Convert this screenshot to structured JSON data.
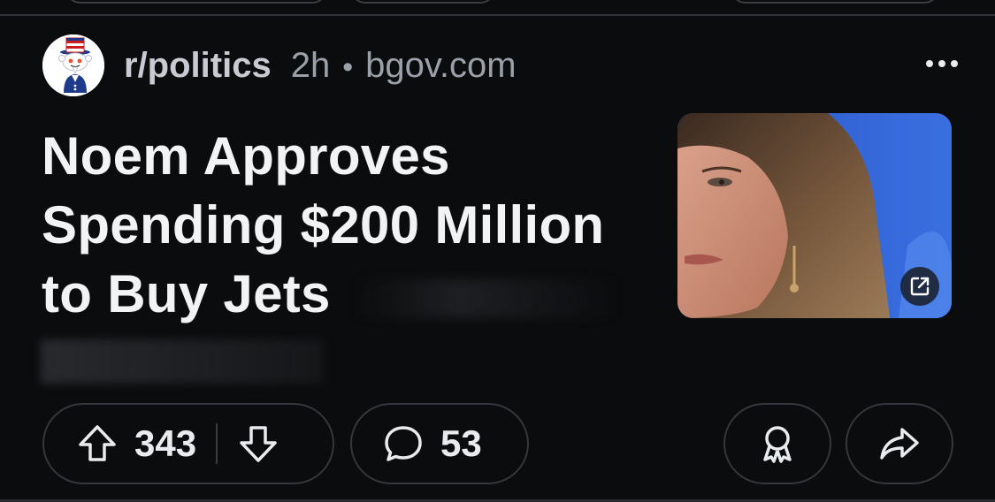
{
  "post": {
    "subreddit": "r/politics",
    "time": "2h",
    "separator": "•",
    "domain": "bgov.com",
    "title": "Noem Approves Spending $200 Million to Buy Jets"
  },
  "actions": {
    "upvotes": "343",
    "comments": "53"
  },
  "icons": {
    "more": "more-options-icon",
    "upvote": "arrow-up-icon",
    "downvote": "arrow-down-icon",
    "comment": "speech-bubble-icon",
    "award": "award-icon",
    "share": "share-arrow-icon",
    "external": "external-link-icon"
  },
  "colors": {
    "background": "#0b0c0e",
    "text_primary": "#f1f3f5",
    "text_secondary": "#9aa1a9",
    "border": "#34373c"
  }
}
